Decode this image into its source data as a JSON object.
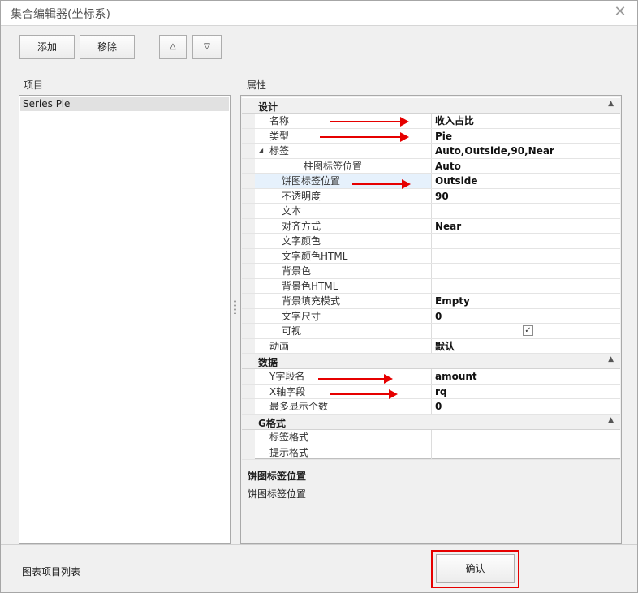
{
  "window": {
    "title": "集合编辑器(坐标系)",
    "close_glyph": "✕"
  },
  "toolbar": {
    "add_label": "添加",
    "remove_label": "移除",
    "up_glyph": "△",
    "down_glyph": "▽"
  },
  "items_section": {
    "label": "项目",
    "items": [
      "Series Pie"
    ]
  },
  "properties_section": {
    "label": "属性",
    "categories": [
      {
        "name": "设计",
        "rows": [
          {
            "name": "名称",
            "value": "收入占比"
          },
          {
            "name": "类型",
            "value": "Pie"
          },
          {
            "name": "标签",
            "value": "Auto,Outside,90,Near"
          },
          {
            "name": "柱图标签位置",
            "value": "Auto"
          },
          {
            "name": "饼图标签位置",
            "value": "Outside"
          },
          {
            "name": "不透明度",
            "value": "90"
          },
          {
            "name": "文本",
            "value": ""
          },
          {
            "name": "对齐方式",
            "value": "Near"
          },
          {
            "name": "文字颜色",
            "value": ""
          },
          {
            "name": "文字颜色HTML",
            "value": ""
          },
          {
            "name": "背景色",
            "value": ""
          },
          {
            "name": "背景色HTML",
            "value": ""
          },
          {
            "name": "背景填充模式",
            "value": "Empty"
          },
          {
            "name": "文字尺寸",
            "value": "0"
          },
          {
            "name": "可视",
            "value": ""
          },
          {
            "name": "动画",
            "value": "默认"
          }
        ]
      },
      {
        "name": "数据",
        "rows": [
          {
            "name": "Y字段名",
            "value": "amount"
          },
          {
            "name": "X轴字段",
            "value": "rq"
          },
          {
            "name": "最多显示个数",
            "value": "0"
          }
        ]
      },
      {
        "name": "G格式",
        "rows": [
          {
            "name": "标签格式",
            "value": ""
          },
          {
            "name": "提示格式",
            "value": ""
          }
        ]
      }
    ],
    "collapse_glyph": "▲",
    "expand_glyph": "◢",
    "checkbox_glyph": "✓"
  },
  "description": {
    "title": "饼图标签位置",
    "text": "饼图标签位置"
  },
  "footer": {
    "label": "图表项目列表",
    "confirm_label": "确认"
  },
  "colors": {
    "annotation_red": "#e60000",
    "selected_row": "#e6f1fc"
  }
}
